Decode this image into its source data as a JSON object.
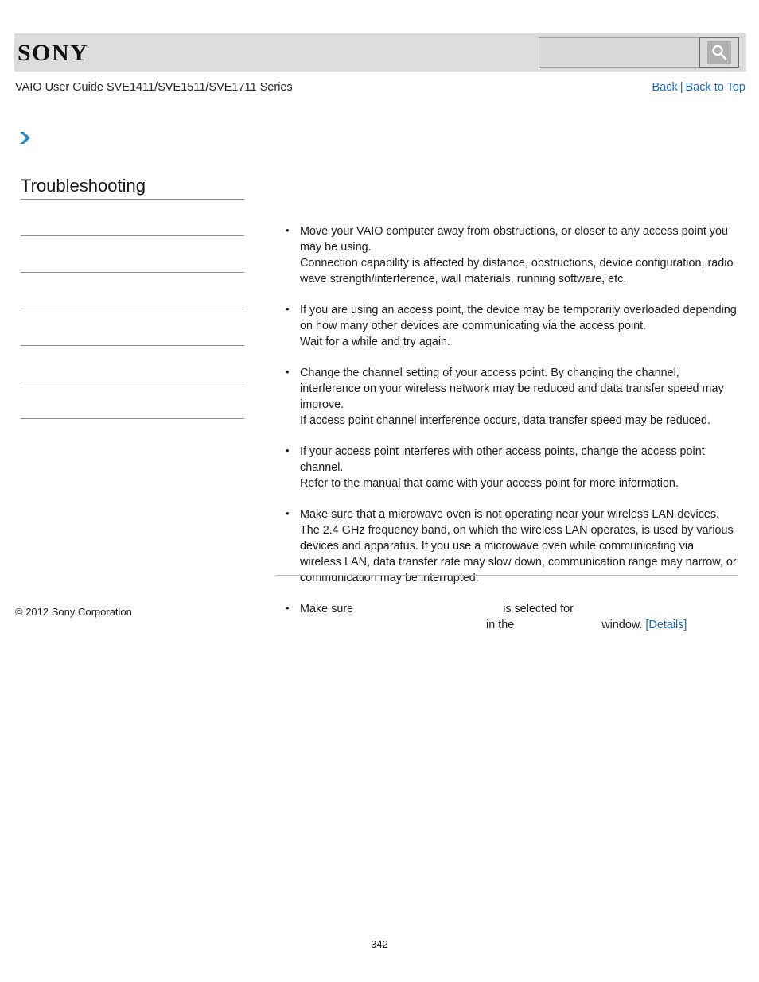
{
  "header": {
    "logo_text": "SONY",
    "guide_title": "VAIO User Guide SVE1411/SVE1511/SVE1711 Series",
    "search": {
      "value": "",
      "placeholder": "",
      "icon": "search-icon"
    },
    "nav": {
      "back_label": "Back",
      "separator": "|",
      "back_to_top_label": "Back to Top"
    }
  },
  "sidebar": {
    "marker_icon": "double-chevron-right-icon",
    "title": "Troubleshooting",
    "items": [
      {
        "label": ""
      },
      {
        "label": ""
      },
      {
        "label": ""
      },
      {
        "label": ""
      },
      {
        "label": ""
      },
      {
        "label": ""
      }
    ]
  },
  "main": {
    "bullets": [
      {
        "lines": [
          "Move your VAIO computer away from obstructions, or closer to any access point you may be using.",
          "Connection capability is affected by distance, obstructions, device configuration, radio wave strength/interference, wall materials, running software, etc."
        ]
      },
      {
        "lines": [
          "If you are using an access point, the device may be temporarily overloaded depending on how many other devices are communicating via the access point.",
          "Wait for a while and try again."
        ]
      },
      {
        "lines": [
          "Change the channel setting of your access point. By changing the channel, interference on your wireless network may be reduced and data transfer speed may improve.",
          "If access point channel interference occurs, data transfer speed may be reduced."
        ]
      },
      {
        "lines": [
          "If your access point interferes with other access points, change the access point channel.",
          "Refer to the manual that came with your access point for more information."
        ]
      },
      {
        "lines": [
          "Make sure that a microwave oven is not operating near your wireless LAN devices.",
          "The 2.4 GHz frequency band, on which the wireless LAN operates, is used by various devices and apparatus. If you use a microwave oven while communicating via wireless LAN, data transfer rate may slow down, communication range may narrow, or communication may be interrupted."
        ]
      }
    ],
    "last_bullet": {
      "part1": "Make sure",
      "part2": "is selected for",
      "part3": "in the",
      "part4": "window.",
      "details_label": "[Details]"
    }
  },
  "footer": {
    "copyright": "© 2012 Sony Corporation",
    "page_number": "342"
  },
  "colors": {
    "link": "#1769c4",
    "header_band": "#dcdcdc",
    "rule": "#8d8d8d"
  }
}
